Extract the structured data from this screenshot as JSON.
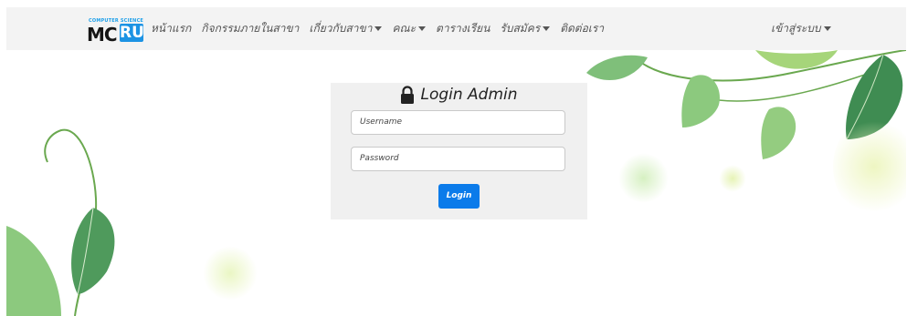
{
  "brand": {
    "logo_top": "COMPUTER SCIENCE",
    "logo_left": "MC",
    "logo_right": "RU"
  },
  "nav": {
    "items": [
      {
        "label": "หน้าแรก",
        "dropdown": false
      },
      {
        "label": "กิจกรรมภายในสาขา",
        "dropdown": false
      },
      {
        "label": "เกี่ยวกับสาขา",
        "dropdown": true
      },
      {
        "label": "คณะ",
        "dropdown": true
      },
      {
        "label": "ตารางเรียน",
        "dropdown": false
      },
      {
        "label": "รับสมัคร",
        "dropdown": true
      },
      {
        "label": "ติดต่อเรา",
        "dropdown": false
      }
    ],
    "login_menu": "เข้าสู่ระบบ"
  },
  "login": {
    "title": "Login Admin",
    "username_placeholder": "Username",
    "password_placeholder": "Password",
    "button": "Login"
  },
  "colors": {
    "accent": "#0b7bea",
    "leaf": "#4f9a5c",
    "navbar": "#f3f3f3",
    "panel": "#f0f0f0"
  },
  "icons": [
    "lock-icon",
    "caret-down-icon"
  ]
}
